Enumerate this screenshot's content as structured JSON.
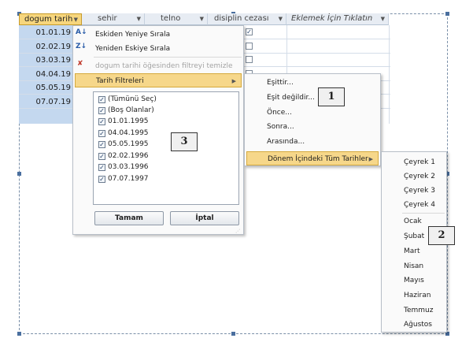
{
  "grid": {
    "headers": [
      "dogum tarih",
      "sehir",
      "telno",
      "disiplin cezası",
      "Eklemek İçin Tıklatın"
    ],
    "dates": [
      "01.01.19",
      "02.02.19",
      "03.03.19",
      "04.04.19",
      "05.05.19",
      "07.07.19"
    ]
  },
  "filter_menu": {
    "sort_asc": "Eskiden Yeniye Sırala",
    "sort_desc": "Yeniden Eskiye Sırala",
    "clear_filter": "dogum tarihi öğesinden filtreyi temizle",
    "date_filters": "Tarih Filtreleri",
    "list": [
      "(Tümünü Seç)",
      "(Boş Olanlar)",
      "01.01.1995",
      "04.04.1995",
      "05.05.1995",
      "02.02.1996",
      "03.03.1996",
      "07.07.1997"
    ],
    "ok": "Tamam",
    "cancel": "İptal"
  },
  "date_filter_menu": {
    "items": [
      "Eşittir...",
      "Eşit değildir...",
      "Önce...",
      "Sonra...",
      "Arasında..."
    ],
    "all_dates": "Dönem İçindeki Tüm Tarihler"
  },
  "period_menu": {
    "quarters": [
      "Çeyrek 1",
      "Çeyrek 2",
      "Çeyrek 3",
      "Çeyrek 4"
    ],
    "months": [
      "Ocak",
      "Şubat",
      "Mart",
      "Nisan",
      "Mayıs",
      "Haziran",
      "Temmuz",
      "Ağustos"
    ]
  },
  "callouts": [
    "1",
    "2",
    "3"
  ]
}
